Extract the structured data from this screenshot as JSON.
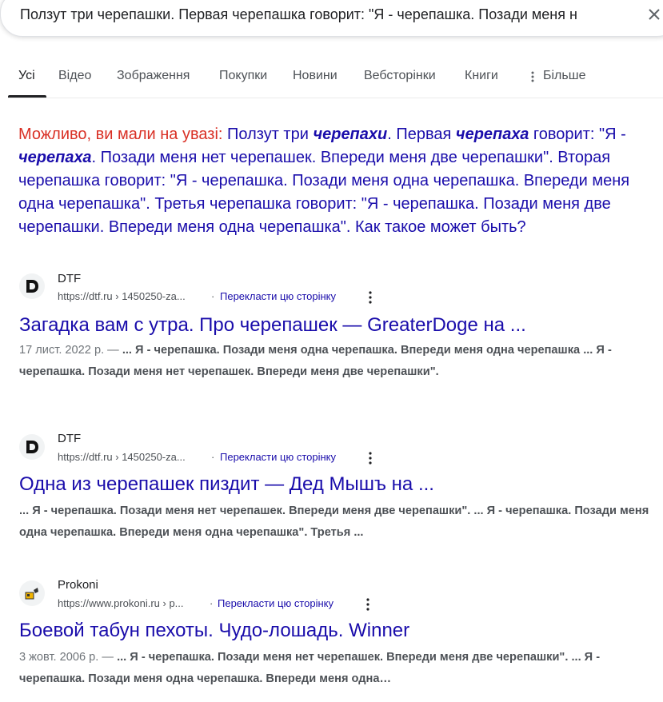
{
  "search": {
    "query": "Ползут три черепашки. Первая черепашка говорит: \"Я - черепашка. Позади меня н"
  },
  "tabs": [
    {
      "label": "Усі",
      "active": true
    },
    {
      "label": "Відео"
    },
    {
      "label": "Зображення"
    },
    {
      "label": "Покупки"
    },
    {
      "label": "Новини"
    },
    {
      "label": "Вебсторінки"
    },
    {
      "label": "Книги"
    },
    {
      "label": "Більше"
    }
  ],
  "suggestion": {
    "lead": "Можливо, ви мали на увазі:",
    "p1": " Ползут три ",
    "b1": "черепахи",
    "p2": ". Первая ",
    "b2": "черепаха",
    "p3": " говорит: \"Я - ",
    "b3": "черепаха",
    "p4": ". Позади меня нет черепашек. Впереди меня две черепашки\". Вторая черепашка говорит: \"Я - черепашка. Позади меня одна черепашка. Впереди меня одна черепашка\". Третья черепашка говорит: \"Я - черепашка. Позади меня две черепашки. Впереди меня одна черепашка\". Как такое может быть?"
  },
  "results": [
    {
      "site": "DTF",
      "url": "https://dtf.ru › 1450250-za...",
      "translate": "Перекласти цю сторінку",
      "title": "Загадка вам с утра. Про черепашек — GreaterDoge на ...",
      "date": "17 лист. 2022 р. — ",
      "snippet": "... Я - черепашка. Позади меня одна черепашка. Впереди меня одна черепашка ... Я - черепашка. Позади меня нет черепашек. Впереди меня две черепашки\"."
    },
    {
      "site": "DTF",
      "url": "https://dtf.ru › 1450250-za...",
      "translate": "Перекласти цю сторінку",
      "title": "Одна из черепашек пиздит — Дед Мышъ на ...",
      "date": "",
      "snippet": "... Я - черепашка. Позади меня нет черепашек. Впереди меня две черепашки\". ... Я - черепашка. Позади меня одна черепашка. Впереди меня одна черепашка\". Третья ..."
    },
    {
      "site": "Prokoni",
      "url": "https://www.prokoni.ru › p...",
      "translate": "Перекласти цю сторінку",
      "title": "Боевой табун пехоты. Чудо-лошадь. Winner",
      "date": "3 жовт. 2006 р. — ",
      "snippet": "... Я - черепашка. Позади меня нет черепашек. Впереди меня две черепашки\". ... Я - черепашка. Позади меня одна черепашка. Впереди меня одна…"
    }
  ],
  "icons": {
    "clear": "close-icon",
    "more": "more-vert-icon",
    "dtf_favicon": "dtf-logo-icon",
    "prokoni_favicon": "prokoni-logo-icon"
  },
  "colors": {
    "link": "#1a0dab",
    "suggestion_lead": "#d93025",
    "text": "#202124",
    "muted": "#4d5156"
  }
}
